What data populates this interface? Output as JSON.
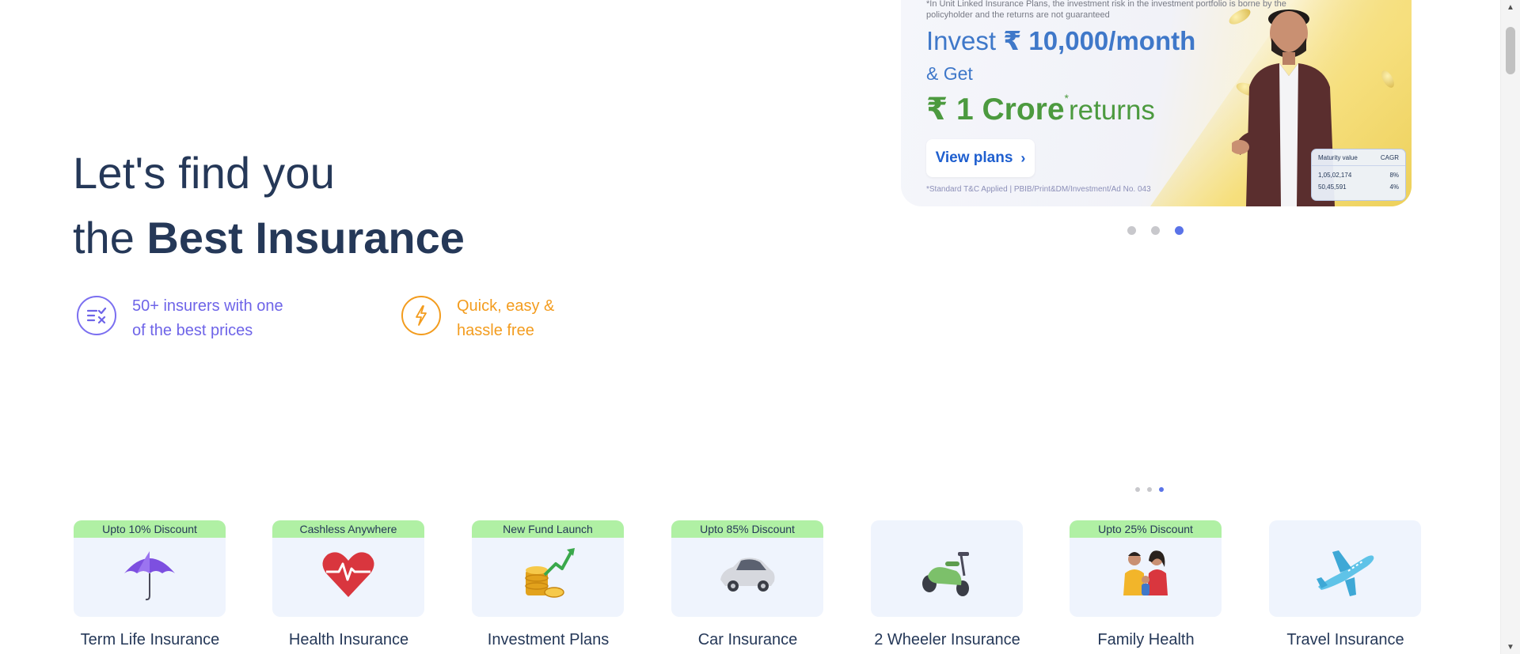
{
  "hero": {
    "line1": "Let's find you",
    "line2_prefix": "the ",
    "line2_bold": "Best Insurance"
  },
  "usps": [
    {
      "line1": "50+ insurers with one",
      "line2": "of the best prices",
      "icon": "compare-icon",
      "color": "#6e64e8"
    },
    {
      "line1": "Quick, easy &",
      "line2": "hassle free",
      "icon": "lightning-icon",
      "color": "#f39c1e"
    }
  ],
  "banner": {
    "disclaimer": "*In Unit Linked Insurance Plans, the investment risk in the investment portfolio is borne by the policyholder and the returns are not guaranteed",
    "invest_prefix": "Invest ",
    "invest_amount": "₹ 10,000/month",
    "get": "& Get",
    "crore": "₹ 1 Crore",
    "crore_star": "*",
    "returns": "returns",
    "cta": "View plans",
    "cta_chevron": "›",
    "tc": "*Standard T&C Applied | PBIB/Print&DM/Investment/Ad No. 043",
    "table": {
      "col1": "Maturity value",
      "col2": "CAGR",
      "rows": [
        {
          "value": "1,05,02,174",
          "cagr": "8%"
        },
        {
          "value": "50,45,591",
          "cagr": "4%"
        }
      ]
    },
    "colors": {
      "blue": "#3f78c9",
      "green": "#4c9a3f",
      "cta": "#1f5fcf"
    }
  },
  "carousel": {
    "slides": 3,
    "active_index": 2,
    "mini_slides": 3,
    "mini_active_index": 2
  },
  "products": [
    {
      "badge": "Upto 10% Discount",
      "label": "Term Life Insurance",
      "icon": "umbrella-icon"
    },
    {
      "badge": "Cashless Anywhere",
      "label": "Health Insurance",
      "icon": "heart-pulse-icon"
    },
    {
      "badge": "New Fund Launch",
      "label": "Investment Plans",
      "icon": "coins-growth-icon"
    },
    {
      "badge": "Upto 85% Discount",
      "label": "Car Insurance",
      "icon": "car-icon"
    },
    {
      "badge": "",
      "label": "2 Wheeler Insurance",
      "icon": "scooter-icon"
    },
    {
      "badge": "Upto 25% Discount",
      "label": "Family Health",
      "icon": "family-icon"
    },
    {
      "badge": "",
      "label": "Travel Insurance",
      "icon": "airplane-icon"
    }
  ]
}
